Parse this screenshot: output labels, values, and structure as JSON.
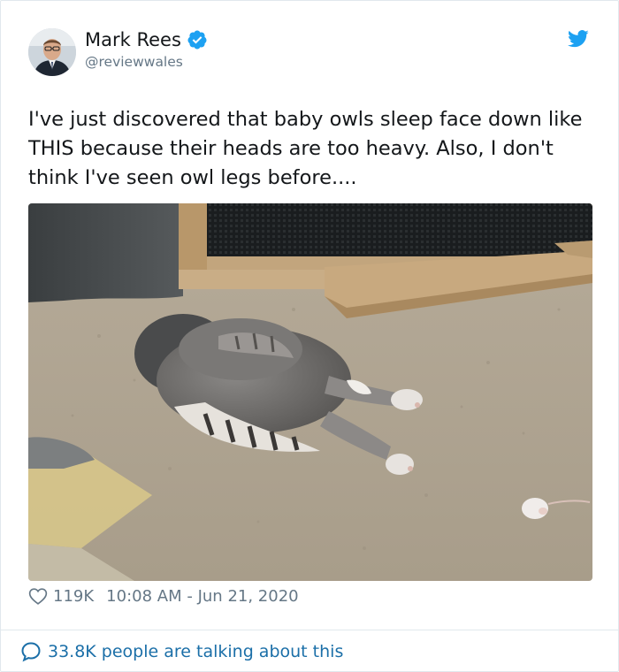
{
  "tweet": {
    "author": {
      "display_name": "Mark Rees",
      "handle": "@reviewwales",
      "verified": true
    },
    "text": "I've just discovered that baby owls sleep face down like THIS because their heads are too heavy. Also, I don't think I've seen owl legs before....",
    "likes": "119K",
    "time": "10:08 AM",
    "separator": "-",
    "date": "Jun 21, 2020",
    "conversation_label": "33.8K people are talking about this"
  },
  "icons": {
    "brand": "twitter-bird-icon",
    "verified": "verified-badge-icon",
    "like": "heart-icon",
    "conversation": "speech-bubble-icon"
  },
  "colors": {
    "brand_blue": "#1da1f2",
    "link_blue": "#1b6fa8",
    "secondary_text": "#657786",
    "border": "#e1e8ed"
  }
}
